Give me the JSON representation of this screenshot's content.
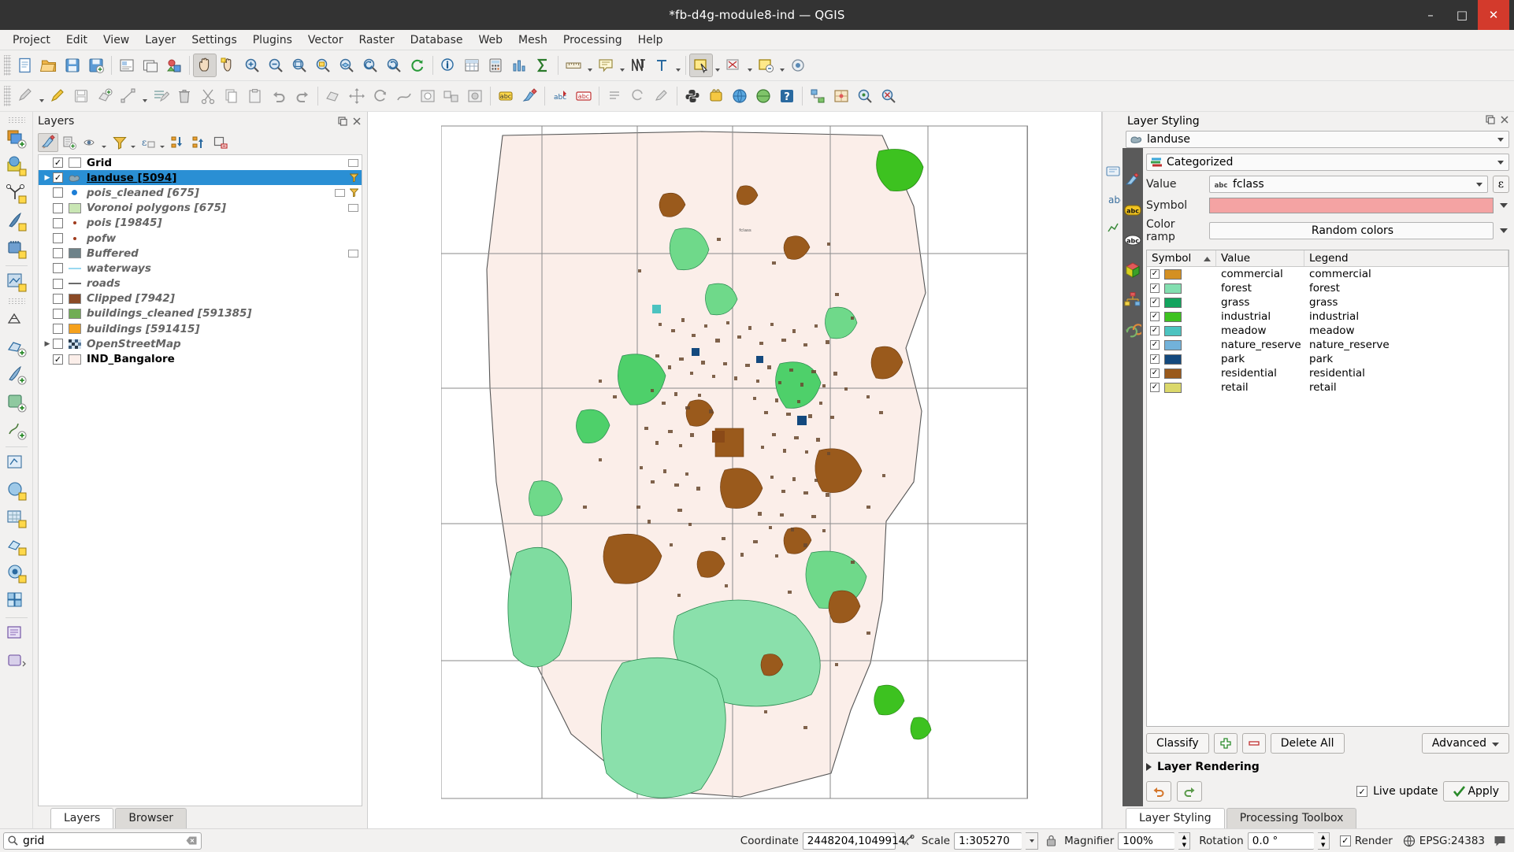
{
  "window": {
    "title": "*fb-d4g-module8-ind — QGIS",
    "minimize": "–",
    "maximize": "□",
    "close": "✕"
  },
  "menubar": [
    "Project",
    "Edit",
    "View",
    "Layer",
    "Settings",
    "Plugins",
    "Vector",
    "Raster",
    "Database",
    "Web",
    "Mesh",
    "Processing",
    "Help"
  ],
  "layers_panel": {
    "title": "Layers",
    "toolbar": [
      "styling-dock-icon",
      "add-group-icon",
      "manage-visibility-icon",
      "filter-legend-icon",
      "filter-legend-expression-icon",
      "expand-all-icon",
      "collapse-all-icon",
      "remove-layer-icon"
    ],
    "items": [
      {
        "name": "Grid",
        "checked": true,
        "bold": true,
        "symbol": "polygon-empty",
        "color": "#ffffff",
        "hasIndicator": true
      },
      {
        "name": "landuse [5094]",
        "checked": true,
        "bold": true,
        "symbol": "categorized",
        "color": "#7a9aa8",
        "selected": true,
        "expandable": true,
        "hasFilter": true
      },
      {
        "name": "pois_cleaned [675]",
        "checked": false,
        "symbol": "point-big",
        "color": "#1c7ed6",
        "hasIndicator": true,
        "hasFilter": true
      },
      {
        "name": "Voronoi polygons [675]",
        "checked": false,
        "symbol": "polygon",
        "color": "#c9e6b4",
        "hasIndicator": true
      },
      {
        "name": "pois [19845]",
        "checked": false,
        "symbol": "point-small",
        "color": "#a03c1e"
      },
      {
        "name": "pofw",
        "checked": false,
        "symbol": "point-small",
        "color": "#a03c1e"
      },
      {
        "name": "Buffered",
        "checked": false,
        "symbol": "polygon",
        "color": "#6d8289",
        "hasIndicator": true
      },
      {
        "name": "waterways",
        "checked": false,
        "symbol": "line",
        "color": "#9ad9f0"
      },
      {
        "name": "roads",
        "checked": false,
        "symbol": "line",
        "color": "#6a6a6a"
      },
      {
        "name": "Clipped [7942]",
        "checked": false,
        "symbol": "polygon",
        "color": "#8a4a26"
      },
      {
        "name": "buildings_cleaned [591385]",
        "checked": false,
        "symbol": "polygon",
        "color": "#70ad54"
      },
      {
        "name": "buildings [591415]",
        "checked": false,
        "symbol": "polygon",
        "color": "#f5a11c"
      },
      {
        "name": "OpenStreetMap",
        "checked": false,
        "symbol": "raster",
        "color": "#7fa9c8",
        "expandable": true
      },
      {
        "name": "IND_Bangalore",
        "checked": true,
        "bold": true,
        "symbol": "polygon",
        "color": "#fbeee9"
      }
    ],
    "tabs": [
      {
        "label": "Layers",
        "active": true
      },
      {
        "label": "Browser",
        "active": false
      }
    ]
  },
  "layer_styling": {
    "title": "Layer Styling",
    "layer_selector": {
      "value": "landuse",
      "icon": "polygon-layer-icon"
    },
    "renderer": {
      "value": "Categorized",
      "icon": "categorized-icon"
    },
    "value_label": "Value",
    "value_field": "fclass",
    "value_field_icon": "abc",
    "symbol_label": "Symbol",
    "symbol_color": "#f4a3a3",
    "color_ramp_label": "Color ramp",
    "color_ramp_value": "Random colors",
    "expression_button": "ε",
    "table": {
      "columns": [
        "Symbol",
        "Value",
        "Legend"
      ],
      "sort_column": "Symbol",
      "sort_dir": "asc",
      "rows": [
        {
          "checked": true,
          "color": "#d49022",
          "value": "commercial",
          "legend": "commercial"
        },
        {
          "checked": true,
          "color": "#83dfb0",
          "value": "forest",
          "legend": "forest"
        },
        {
          "checked": true,
          "color": "#13a45e",
          "value": "grass",
          "legend": "grass"
        },
        {
          "checked": true,
          "color": "#3dc220",
          "value": "industrial",
          "legend": "industrial"
        },
        {
          "checked": true,
          "color": "#4cc3c0",
          "value": "meadow",
          "legend": "meadow"
        },
        {
          "checked": true,
          "color": "#72b2da",
          "value": "nature_reserve",
          "legend": "nature_reserve"
        },
        {
          "checked": true,
          "color": "#13497e",
          "value": "park",
          "legend": "park"
        },
        {
          "checked": true,
          "color": "#9a5a1c",
          "value": "residential",
          "legend": "residential"
        },
        {
          "checked": true,
          "color": "#dbd86a",
          "value": "retail",
          "legend": "retail"
        }
      ]
    },
    "buttons": {
      "classify": "Classify",
      "add": "＋",
      "remove": "－",
      "delete_all": "Delete All",
      "advanced": "Advanced"
    },
    "layer_rendering": "Layer Rendering",
    "undo_icon": "undo-icon",
    "redo_icon": "redo-icon",
    "live_update": {
      "label": "Live update",
      "checked": true
    },
    "apply": "Apply",
    "tabs": [
      {
        "label": "Layer Styling",
        "active": true
      },
      {
        "label": "Processing Toolbox",
        "active": false
      }
    ]
  },
  "statusbar": {
    "search_value": "grid",
    "search_placeholder": "",
    "coordinate_label": "Coordinate",
    "coordinate_value": "2448204,1049914",
    "scale_label": "Scale",
    "scale_value": "1:305270",
    "magnifier_label": "Magnifier",
    "magnifier_value": "100%",
    "rotation_label": "Rotation",
    "rotation_value": "0.0 °",
    "render_label": "Render",
    "render_checked": true,
    "crs_value": "EPSG:24383"
  },
  "map": {
    "background": "#ffffff",
    "polygon_fill": "#fbeee9",
    "polygon_stroke": "#555555",
    "grid_stroke": "#808080",
    "label": "fclass"
  }
}
